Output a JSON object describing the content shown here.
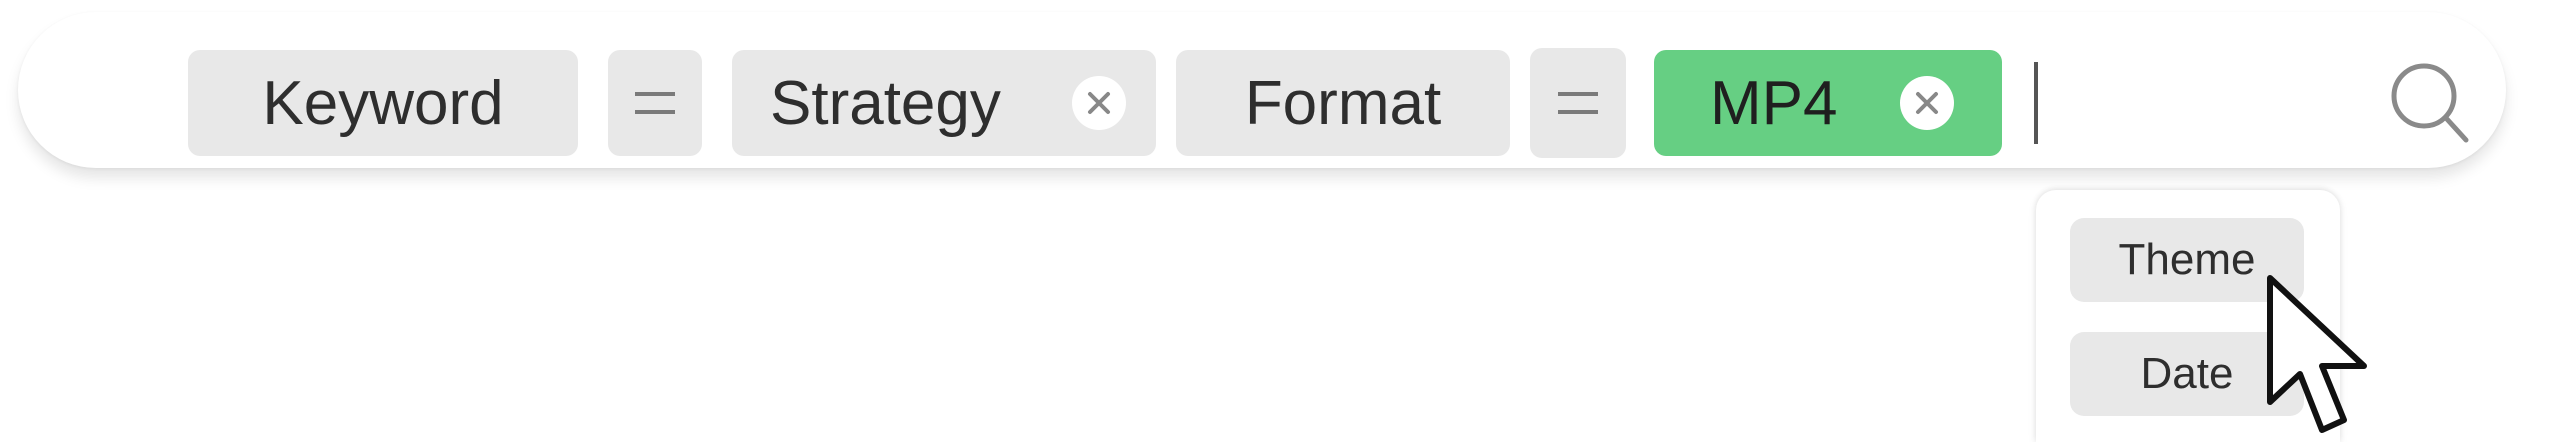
{
  "search_bar": {
    "chips": [
      {
        "label": "Keyword",
        "type": "field"
      },
      {
        "label": "=",
        "type": "operator"
      },
      {
        "label": "Strategy",
        "type": "value",
        "clearable": true
      },
      {
        "label": "Format",
        "type": "field"
      },
      {
        "label": "=",
        "type": "operator"
      },
      {
        "label": "MP4",
        "type": "value",
        "clearable": true,
        "active": true
      }
    ],
    "clear_icon": "close-circle-icon",
    "search_icon": "search-icon",
    "active_chip_color": "#66cf83",
    "chip_color": "#e8e8e8"
  },
  "dropdown": {
    "items": [
      {
        "label": "Theme"
      },
      {
        "label": "Date"
      }
    ]
  },
  "cursor": {
    "icon": "arrow-cursor-icon"
  }
}
